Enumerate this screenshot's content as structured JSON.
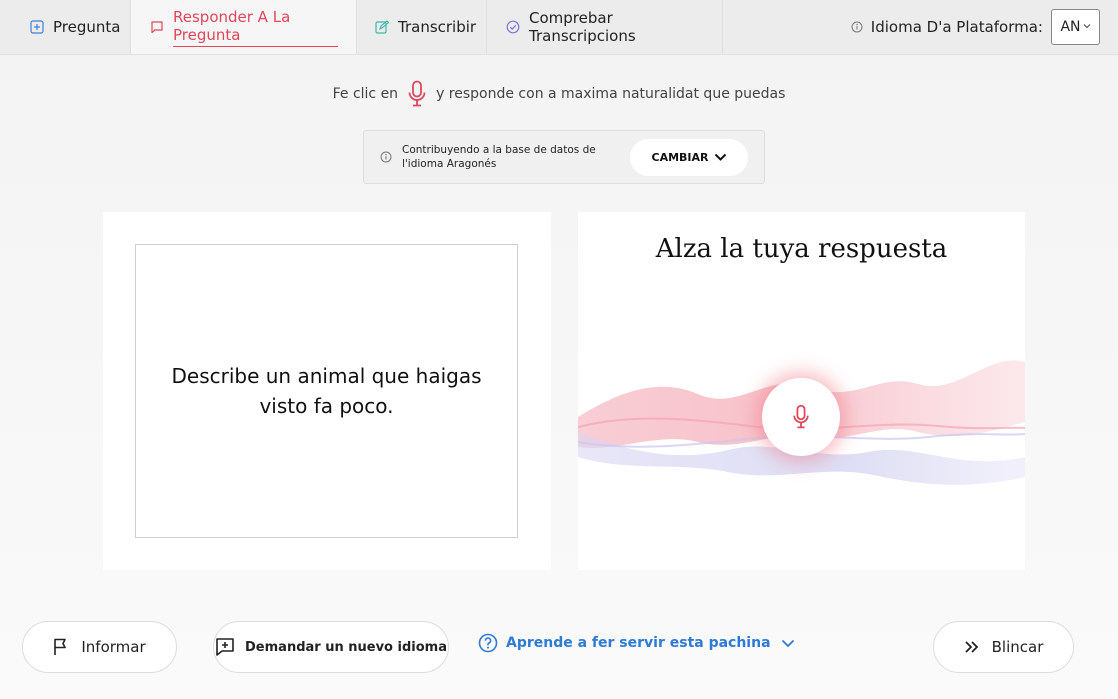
{
  "nav": {
    "tabs": [
      {
        "label": "Pregunta",
        "icon": "plus-square-icon"
      },
      {
        "label": "Responder A La Pregunta",
        "icon": "speech-bubble-icon",
        "active": true
      },
      {
        "label": "Transcribir",
        "icon": "edit-icon"
      },
      {
        "label": "Comprebar Transcripcions",
        "icon": "check-circle-icon"
      }
    ],
    "platform_language_label": "Idioma D'a Plataforma:",
    "platform_language_value": "AN"
  },
  "instruction": {
    "before": "Fe clic en",
    "after": "y responde con a maxima naturalidat que puedas"
  },
  "contribution": {
    "text": "Contribuyendo a la base de datos de l'idioma Aragonés",
    "change_label": "CAMBIAR"
  },
  "prompt": {
    "text": "Describe un animal que haigas visto fa poco."
  },
  "record": {
    "title": "Alza la tuya respuesta"
  },
  "footer": {
    "report_label": "Informar",
    "new_language_label": "Demandar un nuevo idioma",
    "help_label": "Aprende a fer servir esta pachina",
    "skip_label": "Blincar"
  },
  "colors": {
    "accent": "#e0475b",
    "link": "#2f7bd4"
  }
}
